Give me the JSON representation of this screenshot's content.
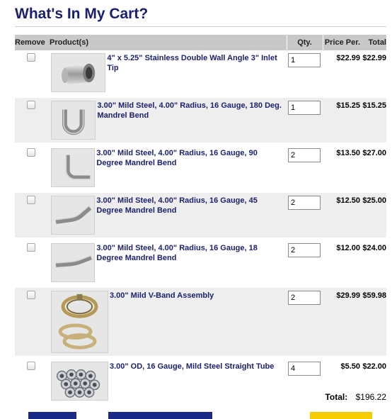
{
  "page": {
    "title": "What's In My Cart?"
  },
  "table": {
    "headers": {
      "remove": "Remove",
      "product": "Product(s)",
      "qty": "Qty.",
      "price": "Price Per.",
      "total": "Total"
    }
  },
  "items": [
    {
      "name": "4\" x 5.25\" Stainless Double Wall Angle 3\" Inlet Tip",
      "qty": "1",
      "price": "$22.99",
      "total": "$22.99",
      "icon": "exhaust-tip-icon"
    },
    {
      "name": "3.00\" Mild Steel, 4.00\" Radius, 16 Gauge, 180 Deg. Mandrel Bend",
      "qty": "1",
      "price": "$15.25",
      "total": "$15.25",
      "icon": "u-bend-icon"
    },
    {
      "name": "3.00\" Mild Steel, 4.00\" Radius, 16 Gauge, 90 Degree Mandrel Bend",
      "qty": "2",
      "price": "$13.50",
      "total": "$27.00",
      "icon": "elbow-90-icon"
    },
    {
      "name": "3.00\" Mild Steel, 4.00\" Radius, 16 Gauge, 45 Degree Mandrel Bend",
      "qty": "2",
      "price": "$12.50",
      "total": "$25.00",
      "icon": "bend-45-icon"
    },
    {
      "name": "3.00\" Mild Steel, 4.00\" Radius, 16 Gauge, 18 Degree Mandrel Bend",
      "qty": "2",
      "price": "$12.00",
      "total": "$24.00",
      "icon": "bend-18-icon"
    },
    {
      "name": "3.00\" Mild V-Band Assembly",
      "qty": "2",
      "price": "$29.99",
      "total": "$59.98",
      "icon": "v-band-clamp-icon"
    },
    {
      "name": "3.00\" OD, 16 Gauge, Mild Steel Straight Tube",
      "qty": "4",
      "price": "$5.50",
      "total": "$22.00",
      "icon": "straight-tube-bundle-icon"
    }
  ],
  "summary": {
    "total_label": "Total:",
    "total_value": "$196.22"
  },
  "colors": {
    "heading": "#1a1f6e",
    "header_bg": "#c8c8c8",
    "row_shade": "#eeeeee",
    "button_blue": "#1c2a87",
    "button_yellow": "#f4cc00"
  }
}
